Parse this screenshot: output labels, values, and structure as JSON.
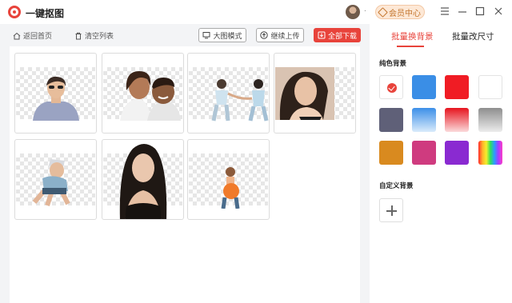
{
  "app": {
    "title": "一键抠图",
    "separator_dot": "."
  },
  "header": {
    "vip_label": "会员中心",
    "menu_icon": "menu-icon",
    "minimize_icon": "minimize-icon",
    "maximize_icon": "maximize-icon",
    "close_icon": "close-icon"
  },
  "toolbar": {
    "back_label": "返回首页",
    "clear_label": "清空列表",
    "large_view_label": "大图模式",
    "continue_upload_label": "继续上传",
    "download_all_label": "全部下载"
  },
  "panel": {
    "tabs": [
      {
        "label": "批量换背景",
        "active": true
      },
      {
        "label": "批量改尺寸",
        "active": false
      }
    ],
    "solid_section_label": "纯色背景",
    "custom_section_label": "自定义背景",
    "swatches": [
      {
        "name": "transparent",
        "color": "#ffffff",
        "selected": true
      },
      {
        "name": "blue",
        "color": "#3a8ee6"
      },
      {
        "name": "red",
        "color": "#f01c24"
      },
      {
        "name": "white",
        "color": "#ffffff"
      },
      {
        "name": "slate",
        "color": "#5f6078"
      },
      {
        "name": "blue-gradient",
        "color": "#6aaef0"
      },
      {
        "name": "red-gradient",
        "color": "#e8262e"
      },
      {
        "name": "gray-gradient",
        "color": "#9a9a9a"
      },
      {
        "name": "orange",
        "color": "#d98a1f"
      },
      {
        "name": "pink",
        "color": "#cf3b7f"
      },
      {
        "name": "purple",
        "color": "#8a2ad1"
      },
      {
        "name": "rainbow",
        "color": "#ff0000"
      }
    ]
  },
  "colors": {
    "accent": "#e8433b",
    "vip_bg": "#fde8d6",
    "vip_text": "#c4762f"
  }
}
